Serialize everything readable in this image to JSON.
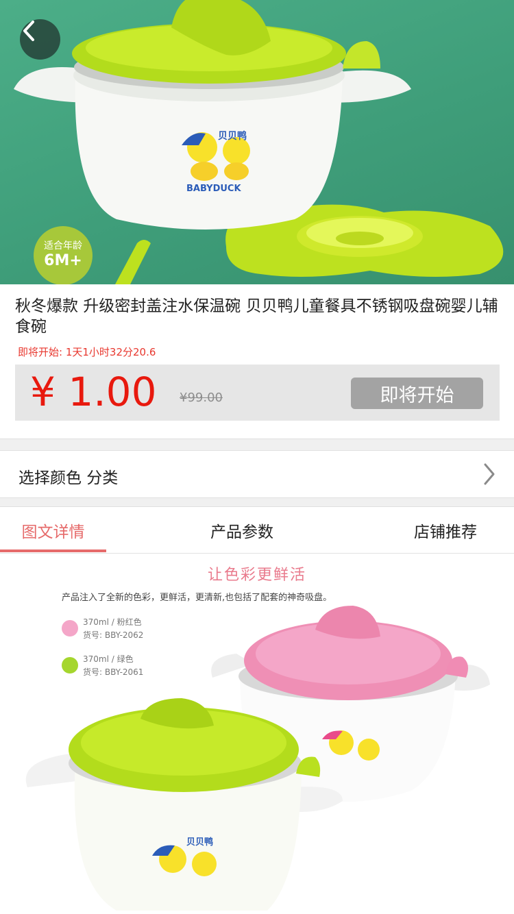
{
  "hero": {
    "brand_cn": "贝贝鸭",
    "brand_en": "BABYDUCK",
    "age_line1": "适合年龄",
    "age_line2": "6M+"
  },
  "product": {
    "title": "秋冬爆款 升级密封盖注水保温碗 贝贝鸭儿童餐具不锈钢吸盘碗婴儿辅食碗",
    "countdown": "即将开始: 1天1小时32分20.6",
    "price": "¥ 1.00",
    "original_price": "¥99.00",
    "action_label": "即将开始"
  },
  "options": {
    "label": "选择颜色 分类"
  },
  "tabs": [
    {
      "label": "图文详情",
      "active": true
    },
    {
      "label": "产品参数",
      "active": false
    },
    {
      "label": "店铺推荐",
      "active": false
    }
  ],
  "detail": {
    "heading": "让色彩更鲜活",
    "description": "产品注入了全新的色彩，更鲜活，更清新,也包括了配套的神奇吸盘。",
    "variants": [
      {
        "line1": "370ml / 粉红色",
        "line2": "货号: BBY-2062",
        "color": "#f4a6c8"
      },
      {
        "line1": "370ml / 绿色",
        "line2": "货号: BBY-2061",
        "color": "#a5d62e"
      }
    ]
  },
  "colors": {
    "accent": "#e66a6a",
    "price": "#e8190e",
    "countdown": "#e8372e",
    "button_disabled": "#a3a3a3",
    "lid_green": "#b3dc1c",
    "lid_pink": "#ef8fb5"
  }
}
